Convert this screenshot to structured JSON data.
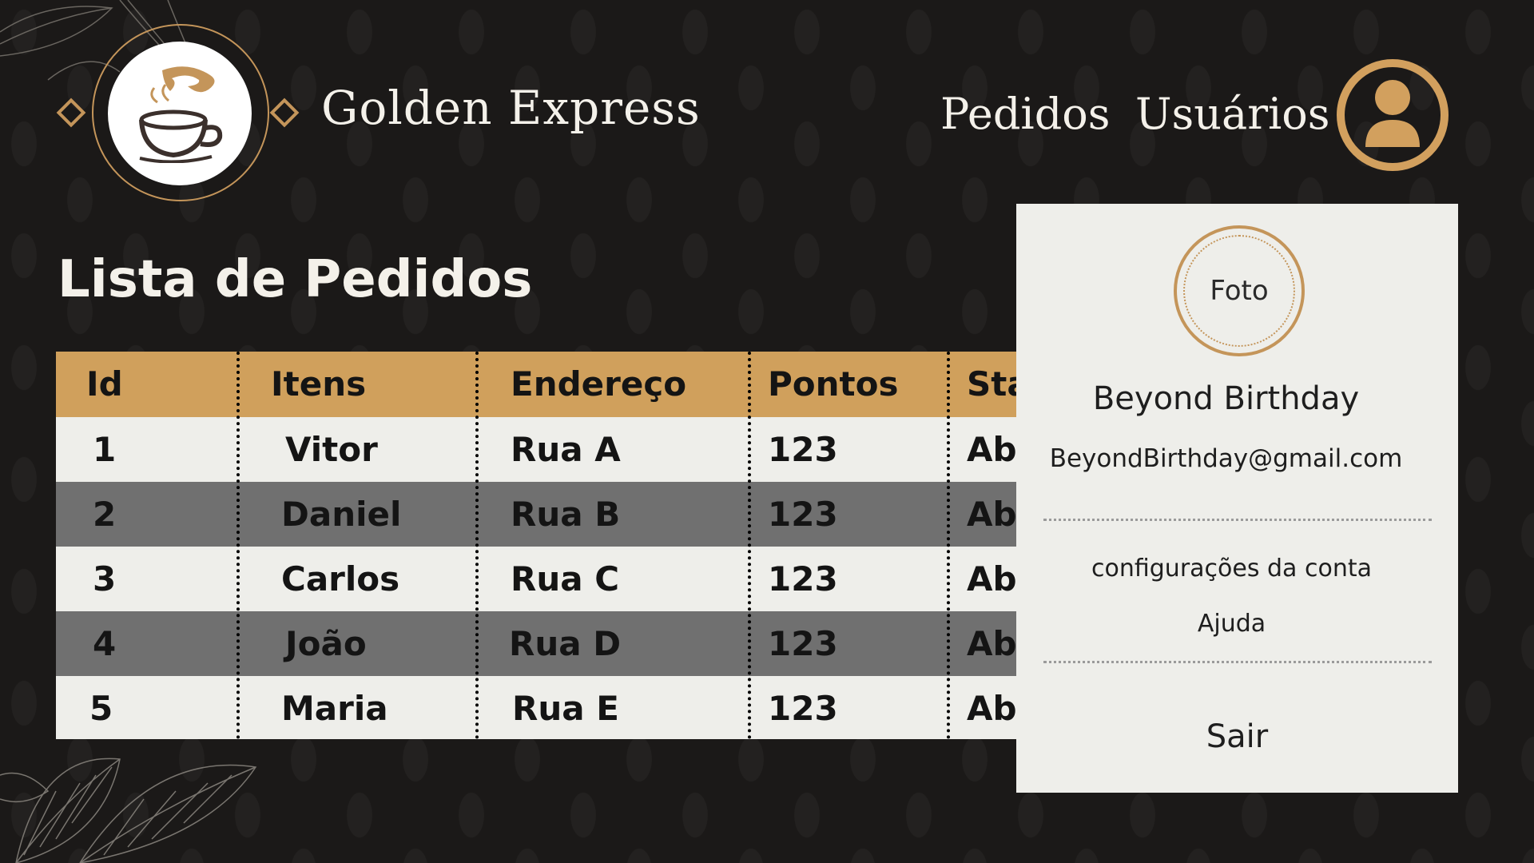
{
  "header": {
    "brand": "Golden Express",
    "nav": [
      "Pedidos",
      "Usuários"
    ],
    "logo_icon": "coffee-cup-icon",
    "avatar_icon": "user-icon"
  },
  "page": {
    "title": "Lista de Pedidos"
  },
  "table": {
    "columns": [
      "Id",
      "Itens",
      "Endereço",
      "Pontos",
      "Sta"
    ],
    "rows": [
      [
        "1",
        "Vitor",
        "Rua A",
        "123",
        "Ab"
      ],
      [
        "2",
        "Daniel",
        "Rua B",
        "123",
        "Ab"
      ],
      [
        "3",
        "Carlos",
        "Rua C",
        "123",
        "Ab"
      ],
      [
        "4",
        "João",
        "Rua D",
        "123",
        "Ab"
      ],
      [
        "5",
        "Maria",
        "Rua E",
        "123",
        "Ab"
      ]
    ]
  },
  "user_menu": {
    "photo_label": "Foto",
    "name": "Beyond Birthday",
    "email": "BeyondBirthday@gmail.com",
    "items": [
      "configurações da conta",
      "Ajuda"
    ],
    "logout": "Sair"
  },
  "colors": {
    "background": "#1b1918",
    "accent": "#d0a05c",
    "row_light": "#eeeeea",
    "row_dark": "#707070",
    "panel": "#eeeeea"
  }
}
